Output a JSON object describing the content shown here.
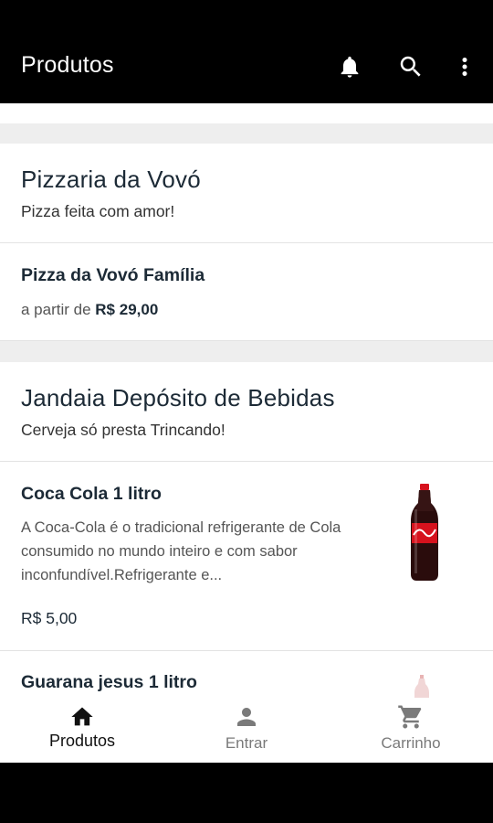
{
  "appbar": {
    "title": "Produtos",
    "icons": [
      "bell-icon",
      "search-icon",
      "more-vert-icon"
    ]
  },
  "stores": [
    {
      "name": "Pizzaria da Vovó",
      "description": "Pizza feita com amor!",
      "products": [
        {
          "name": "Pizza da Vovó Família",
          "price_prefix": "a partir de",
          "price": "R$ 29,00"
        }
      ]
    },
    {
      "name": "Jandaia Depósito de Bebidas",
      "description": "Cerveja só presta Trincando!",
      "products": [
        {
          "name": "Coca Cola 1 litro",
          "description": "A Coca-Cola é o tradicional refrigerante de Cola consumido no mundo inteiro e com sabor inconfundível.Refrigerante e...",
          "price": "R$ 5,00",
          "image": "coca-cola-bottle"
        },
        {
          "name": "Guarana jesus 1 litro",
          "image": "guarana-bottle"
        }
      ]
    }
  ],
  "bottom_nav": {
    "items": [
      {
        "label": "Produtos",
        "icon": "home-icon",
        "active": true
      },
      {
        "label": "Entrar",
        "icon": "person-icon",
        "active": false
      },
      {
        "label": "Carrinho",
        "icon": "cart-icon",
        "active": false
      }
    ]
  },
  "colors": {
    "appbar": "#000000",
    "text_dark": "#1c2a36",
    "divider": "#eeeeee",
    "inactive": "#7a7a7a",
    "coca_red": "#d6121d"
  }
}
